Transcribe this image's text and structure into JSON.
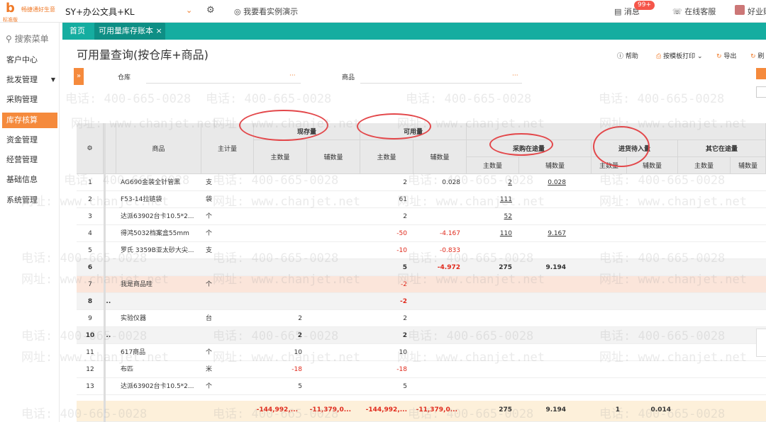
{
  "topbar": {
    "logo_text": "畅捷通好生意",
    "logo_sub": "标准版",
    "account": "SY+办公文具+KL",
    "demo_label": "我要看实例演示",
    "messages_label": "消息",
    "messages_badge": "99+",
    "service_label": "在线客服",
    "user_label": "好业财"
  },
  "sidebar": {
    "search_placeholder": "搜索菜单",
    "items": [
      {
        "label": "客户中心"
      },
      {
        "label": "批发管理"
      },
      {
        "label": "采购管理"
      },
      {
        "label": "库存核算"
      },
      {
        "label": "资金管理"
      },
      {
        "label": "经营管理"
      },
      {
        "label": "基础信息"
      },
      {
        "label": "系统管理"
      }
    ]
  },
  "tabs": {
    "home": "首页",
    "current": "可用量库存账本",
    "close": "×"
  },
  "page": {
    "title": "可用量查询(按仓库+商品)",
    "help": "帮助",
    "print": "按模板打印",
    "export": "导出",
    "refresh": "刷"
  },
  "filters": {
    "warehouse_label": "仓库",
    "goods_label": "商品",
    "dots": "···",
    "expand": "»"
  },
  "table": {
    "headers": {
      "settings": "⚙",
      "goods": "商品",
      "unit": "主计量",
      "stock": "现存量",
      "available": "可用量",
      "purchase_transit": "采购在途量",
      "incoming": "进货待入量",
      "other_transit": "其它在途量",
      "main_qty": "主数量",
      "aux_qty": "辅数量"
    },
    "rows": [
      {
        "idx": "1",
        "goods": "AG690金装全针管黑",
        "unit": "支",
        "s_main": "",
        "s_aux": "",
        "a_main": "2",
        "a_aux": "0.028",
        "p_main": "2",
        "p_aux": "0.028"
      },
      {
        "idx": "2",
        "goods": "F53-14拉链袋",
        "unit": "袋",
        "s_main": "",
        "s_aux": "",
        "a_main": "61",
        "a_aux": "",
        "p_main": "111",
        "p_aux": ""
      },
      {
        "idx": "3",
        "goods": "达派63902台卡10.5*2...",
        "unit": "个",
        "s_main": "",
        "s_aux": "",
        "a_main": "2",
        "a_aux": "",
        "p_main": "52",
        "p_aux": ""
      },
      {
        "idx": "4",
        "goods": "得鸿5032档案盒55mm",
        "unit": "个",
        "s_main": "",
        "s_aux": "",
        "a_main": "-50",
        "a_aux": "-4.167",
        "p_main": "110",
        "p_aux": "9.167"
      },
      {
        "idx": "5",
        "goods": "罗氏 3359B亚太砂大尖...",
        "unit": "支",
        "s_main": "",
        "s_aux": "",
        "a_main": "-10",
        "a_aux": "-0.833",
        "p_main": "",
        "p_aux": ""
      },
      {
        "idx": "6",
        "goods": "",
        "unit": "",
        "s_main": "",
        "s_aux": "",
        "a_main": "5",
        "a_aux": "-4.972",
        "p_main": "275",
        "p_aux": "9.194"
      },
      {
        "idx": "7",
        "goods": "我是商品哇",
        "unit": "个",
        "s_main": "",
        "s_aux": "",
        "a_main": "-2",
        "a_aux": "",
        "p_main": "",
        "p_aux": ""
      },
      {
        "idx": "8",
        "goods": "...",
        "unit": "",
        "s_main": "",
        "s_aux": "",
        "a_main": "-2",
        "a_aux": "",
        "p_main": "",
        "p_aux": ""
      },
      {
        "idx": "9",
        "goods": "实验仪器",
        "unit": "台",
        "s_main": "2",
        "s_aux": "",
        "a_main": "2",
        "a_aux": "",
        "p_main": "",
        "p_aux": ""
      },
      {
        "idx": "10",
        "goods": "...",
        "unit": "",
        "s_main": "2",
        "s_aux": "",
        "a_main": "2",
        "a_aux": "",
        "p_main": "",
        "p_aux": ""
      },
      {
        "idx": "11",
        "goods": "617商品",
        "unit": "个",
        "s_main": "10",
        "s_aux": "",
        "a_main": "10",
        "a_aux": "",
        "p_main": "",
        "p_aux": ""
      },
      {
        "idx": "12",
        "goods": "布匹",
        "unit": "米",
        "s_main": "-18",
        "s_aux": "",
        "a_main": "-18",
        "a_aux": "",
        "p_main": "",
        "p_aux": ""
      },
      {
        "idx": "13",
        "goods": "达派63902台卡10.5*2...",
        "unit": "个",
        "s_main": "5",
        "s_aux": "",
        "a_main": "5",
        "a_aux": "",
        "p_main": "",
        "p_aux": ""
      }
    ],
    "footer": {
      "s_main": "-144,992,...",
      "s_aux": "-11,379,0...",
      "a_main": "-144,992,...",
      "a_aux": "-11,379,0...",
      "p_main": "275",
      "p_aux": "9.194",
      "i_main": "1",
      "i_aux": "0.014"
    }
  },
  "watermark": {
    "phone": "电话: 400-665-0028",
    "site": "网址: www.chanjet.net"
  },
  "colors": {
    "accent": "#f58a3c",
    "teal": "#15ada0",
    "annotation": "#e3474a"
  }
}
